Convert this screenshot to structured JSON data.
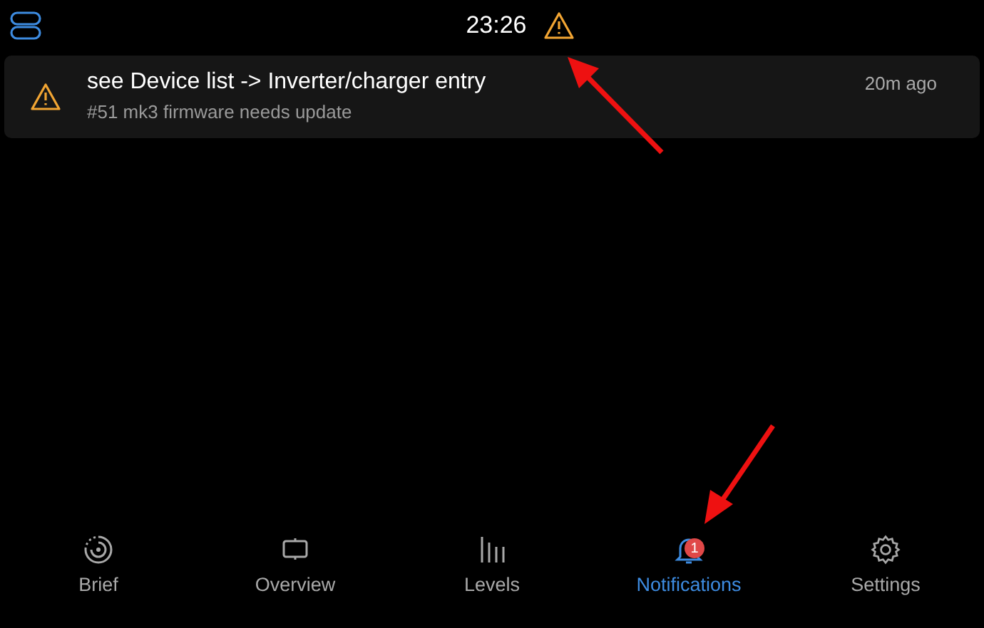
{
  "status_bar": {
    "time": "23:26",
    "alert": true
  },
  "notifications": [
    {
      "kind": "warning",
      "title": "see Device list -> Inverter/charger entry",
      "description": "#51 mk3 firmware needs update",
      "time": "20m ago"
    }
  ],
  "nav": [
    {
      "label": "Brief",
      "kind": "brief",
      "selected": false
    },
    {
      "label": "Overview",
      "kind": "overview",
      "selected": false
    },
    {
      "label": "Levels",
      "kind": "levels",
      "selected": false
    },
    {
      "label": "Notifications",
      "kind": "bell",
      "selected": true,
      "badge": "1"
    },
    {
      "label": "Settings",
      "kind": "gear",
      "selected": false
    }
  ]
}
